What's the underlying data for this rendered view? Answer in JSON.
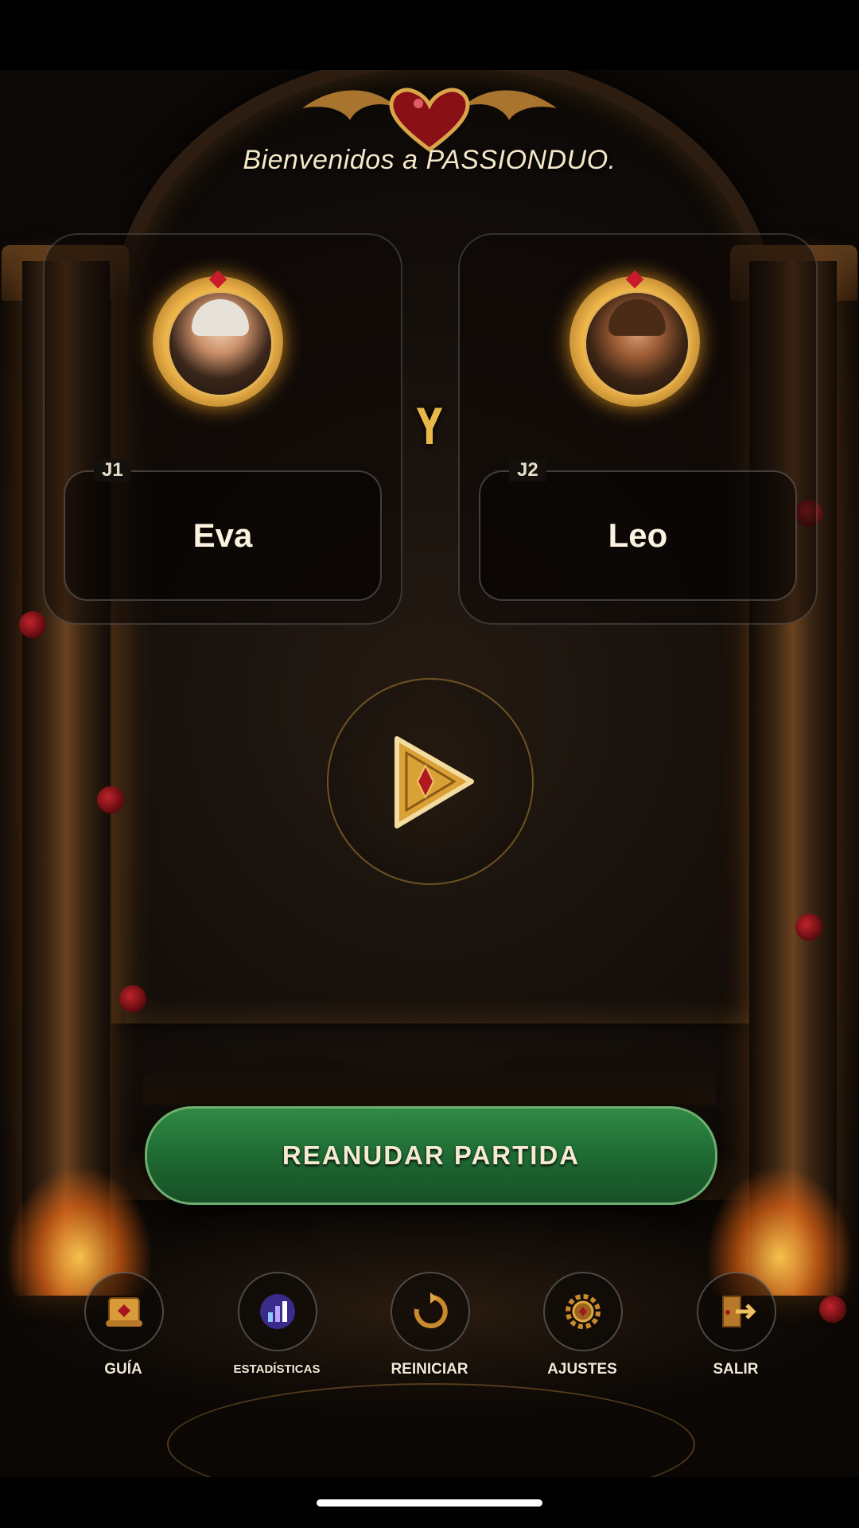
{
  "header": {
    "welcome": "Bienvenidos a PASSIONDUO."
  },
  "players": [
    {
      "tag": "J1",
      "name": "Eva",
      "avatar_icon": "woman-portrait-icon"
    },
    {
      "tag": "J2",
      "name": "Leo",
      "avatar_icon": "man-portrait-icon"
    }
  ],
  "connector": "Y",
  "play_icon": "golden-play-triangle-icon",
  "resume_button": {
    "label": "REANUDAR PARTIDA"
  },
  "menu": [
    {
      "label": "GUÍA",
      "icon": "scroll-book-icon"
    },
    {
      "label": "ESTADÍSTICAS",
      "icon": "stats-chart-icon"
    },
    {
      "label": "REINICIAR",
      "icon": "restart-arrow-icon"
    },
    {
      "label": "AJUSTES",
      "icon": "gear-icon"
    },
    {
      "label": "SALIR",
      "icon": "exit-door-icon"
    }
  ],
  "colors": {
    "accent_gold": "#e8b84a",
    "resume_green": "#1f6b33",
    "heart_red": "#c81c2a"
  }
}
